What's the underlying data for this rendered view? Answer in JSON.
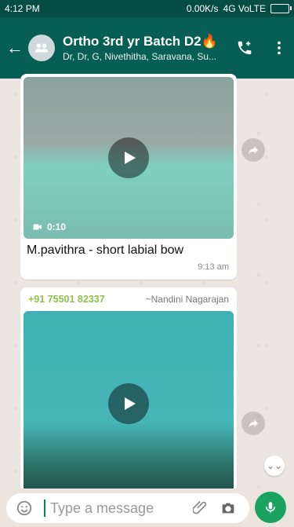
{
  "status": {
    "time": "4:12 PM",
    "network": "0.00K/s",
    "signal": "4G VoLTE"
  },
  "header": {
    "title": "Ortho 3rd yr Batch D2🔥",
    "subtitle": "Dr, Dr, G, Nivethitha, Saravana, Su..."
  },
  "messages": [
    {
      "type": "video",
      "duration": "0:10",
      "caption": "M.pavithra - short labial bow",
      "time": "9:13 am"
    },
    {
      "type": "video",
      "sender_phone": "+91 75501 82337",
      "sender_name": "~Nandini Nagarajan"
    }
  ],
  "composer": {
    "placeholder": "Type a message"
  },
  "colors": {
    "header": "#075e54",
    "status": "#054d44",
    "mic": "#1aa260",
    "sender": "#8bc34a"
  },
  "icons": {
    "back": "back-arrow-icon",
    "group": "group-icon",
    "call": "add-call-icon",
    "menu": "more-vert-icon",
    "play": "play-icon",
    "video": "video-camera-icon",
    "forward": "forward-icon",
    "scroll": "double-chevron-down-icon",
    "emoji": "emoji-icon",
    "attach": "paperclip-icon",
    "camera": "camera-icon",
    "mic": "mic-icon"
  }
}
